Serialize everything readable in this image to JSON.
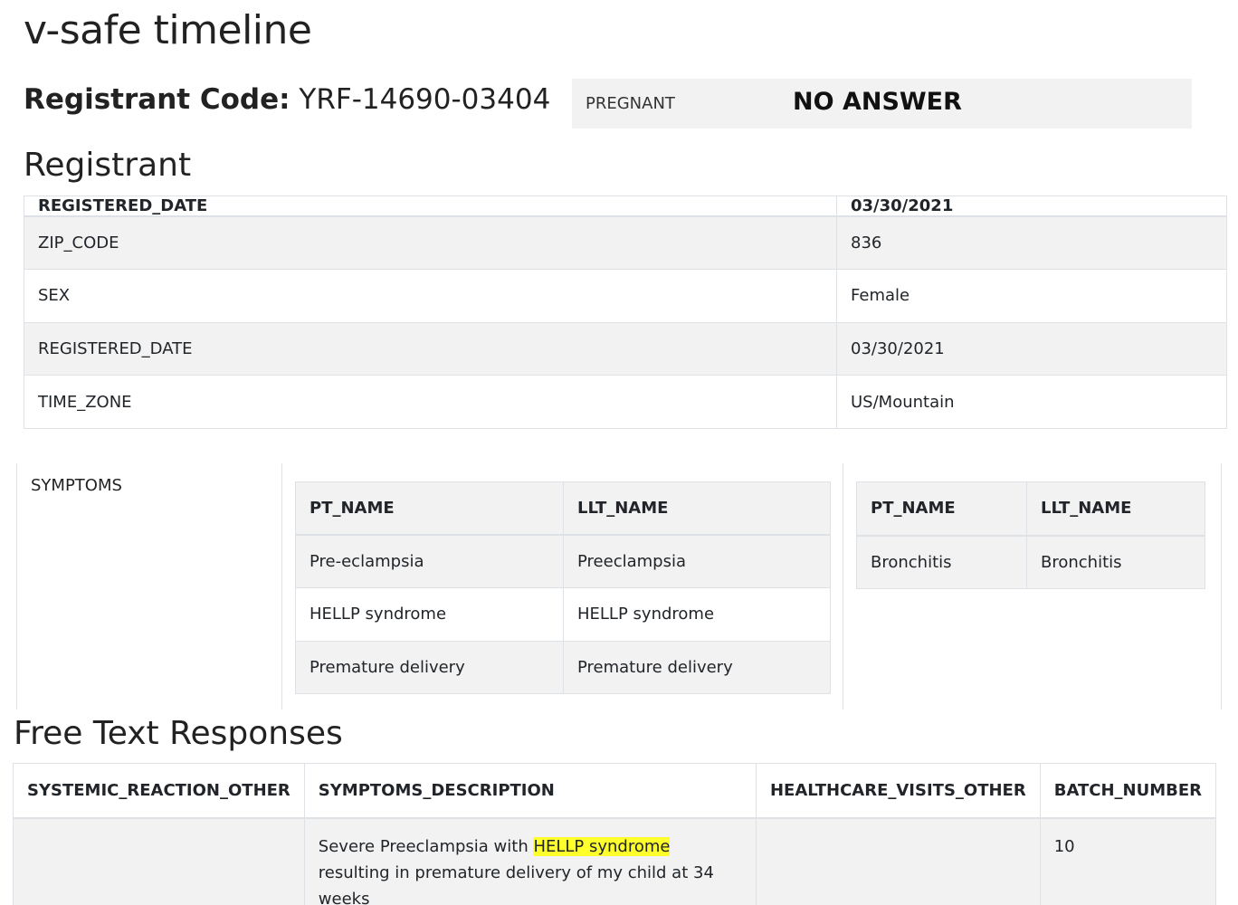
{
  "page": {
    "title": "v-safe timeline"
  },
  "registrant_code": {
    "label": "Registrant Code:",
    "value": "YRF-14690-03404"
  },
  "pregnant": {
    "label": "PREGNANT",
    "value": "NO ANSWER"
  },
  "registrant_section": {
    "heading": "Registrant",
    "rows": [
      {
        "key": "REGISTERED_DATE",
        "value": "03/30/2021",
        "bold": true
      },
      {
        "key": "ZIP_CODE",
        "value": "836"
      },
      {
        "key": "SEX",
        "value": "Female"
      },
      {
        "key": "REGISTERED_DATE",
        "value": "03/30/2021"
      },
      {
        "key": "TIME_ZONE",
        "value": "US/Mountain"
      }
    ]
  },
  "symptoms": {
    "label": "SYMPTOMS",
    "table1": {
      "headers": [
        "PT_NAME",
        "LLT_NAME"
      ],
      "rows": [
        [
          "Pre-eclampsia",
          "Preeclampsia"
        ],
        [
          "HELLP syndrome",
          "HELLP syndrome"
        ],
        [
          "Premature delivery",
          "Premature delivery"
        ]
      ]
    },
    "table2": {
      "headers": [
        "PT_NAME",
        "LLT_NAME"
      ],
      "rows": [
        [
          "Bronchitis",
          "Bronchitis"
        ]
      ]
    }
  },
  "free_text": {
    "heading": "Free Text Responses",
    "headers": [
      "SYSTEMIC_REACTION_OTHER",
      "SYMPTOMS_DESCRIPTION",
      "HEALTHCARE_VISITS_OTHER",
      "BATCH_NUMBER"
    ],
    "row": {
      "systemic_reaction_other": "",
      "symptoms_description_pre": "Severe Preeclampsia with ",
      "symptoms_description_highlight": "HELLP syndrome",
      "symptoms_description_post": " resulting in premature delivery of my child at 34 weeks",
      "healthcare_visits_other": "",
      "batch_number": "10"
    }
  },
  "colors": {
    "highlight": "#ffff2b",
    "stripe": "#f2f2f2",
    "border": "#dee2e6"
  }
}
